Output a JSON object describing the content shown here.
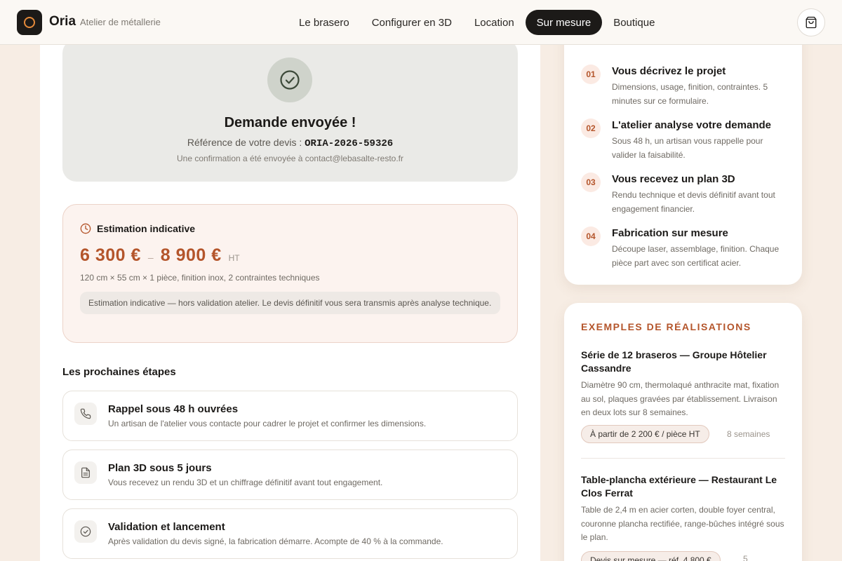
{
  "header": {
    "brand_name": "Oria",
    "brand_sub": "Atelier de métallerie",
    "nav": [
      {
        "label": "Le brasero",
        "active": false
      },
      {
        "label": "Configurer en 3D",
        "active": false
      },
      {
        "label": "Location",
        "active": false
      },
      {
        "label": "Sur mesure",
        "active": true
      },
      {
        "label": "Boutique",
        "active": false
      }
    ],
    "cart_icon": "shopping-bag-icon"
  },
  "confirmation": {
    "title": "Demande envoyée !",
    "ref_label": "Référence de votre devis :",
    "ref_code": "ORIA-2026-59326",
    "confirm_text": "Une confirmation a été envoyée à contact@lebasalte-resto.fr"
  },
  "estimate": {
    "heading": "Estimation indicative",
    "min": "6 300 €",
    "separator": "–",
    "max": "8 900 €",
    "tax": "HT",
    "specs": "120 cm × 55 cm × 1 pièce, finition inox, 2 contraintes techniques",
    "note": "Estimation indicative — hors validation atelier. Le devis définitif vous sera transmis après analyse technique."
  },
  "next_steps": {
    "title": "Les prochaines étapes",
    "items": [
      {
        "title": "Rappel sous 48 h ouvrées",
        "desc": "Un artisan de l'atelier vous contacte pour cadrer le projet et confirmer les dimensions.",
        "icon": "phone-icon"
      },
      {
        "title": "Plan 3D sous 5 jours",
        "desc": "Vous recevez un rendu 3D et un chiffrage définitif avant tout engagement.",
        "icon": "document-icon"
      },
      {
        "title": "Validation et lancement",
        "desc": "Après validation du devis signé, la fabrication démarre. Acompte de 40 % à la commande.",
        "icon": "check-circle-icon"
      }
    ]
  },
  "process": {
    "items": [
      {
        "num": "01",
        "title": "Vous décrivez le projet",
        "desc": "Dimensions, usage, finition, contraintes. 5 minutes sur ce formulaire."
      },
      {
        "num": "02",
        "title": "L'atelier analyse votre demande",
        "desc": "Sous 48 h, un artisan vous rappelle pour valider la faisabilité."
      },
      {
        "num": "03",
        "title": "Vous recevez un plan 3D",
        "desc": "Rendu technique et devis définitif avant tout engagement financier."
      },
      {
        "num": "04",
        "title": "Fabrication sur mesure",
        "desc": "Découpe laser, assemblage, finition. Chaque pièce part avec son certificat acier."
      }
    ]
  },
  "examples": {
    "heading": "EXEMPLES DE RÉALISATIONS",
    "items": [
      {
        "title": "Série de 12 braseros — Groupe Hôtelier Cassandre",
        "desc": "Diamètre 90 cm, thermolaqué anthracite mat, fixation au sol, plaques gravées par établissement. Livraison en deux lots sur 8 semaines.",
        "price": "À partir de 2 200 € / pièce HT",
        "duration": "8 semaines"
      },
      {
        "title": "Table-plancha extérieure — Restaurant Le Clos Ferrat",
        "desc": "Table de 2,4 m en acier corten, double foyer central, couronne plancha rectifiée, range-bûches intégré sous le plan.",
        "price": "Devis sur mesure — réf. 4 800 €",
        "duration": "5"
      }
    ]
  },
  "colors": {
    "accent": "#b4552b",
    "dark": "#1c1a18",
    "logo_ring": "#e58a3a"
  }
}
